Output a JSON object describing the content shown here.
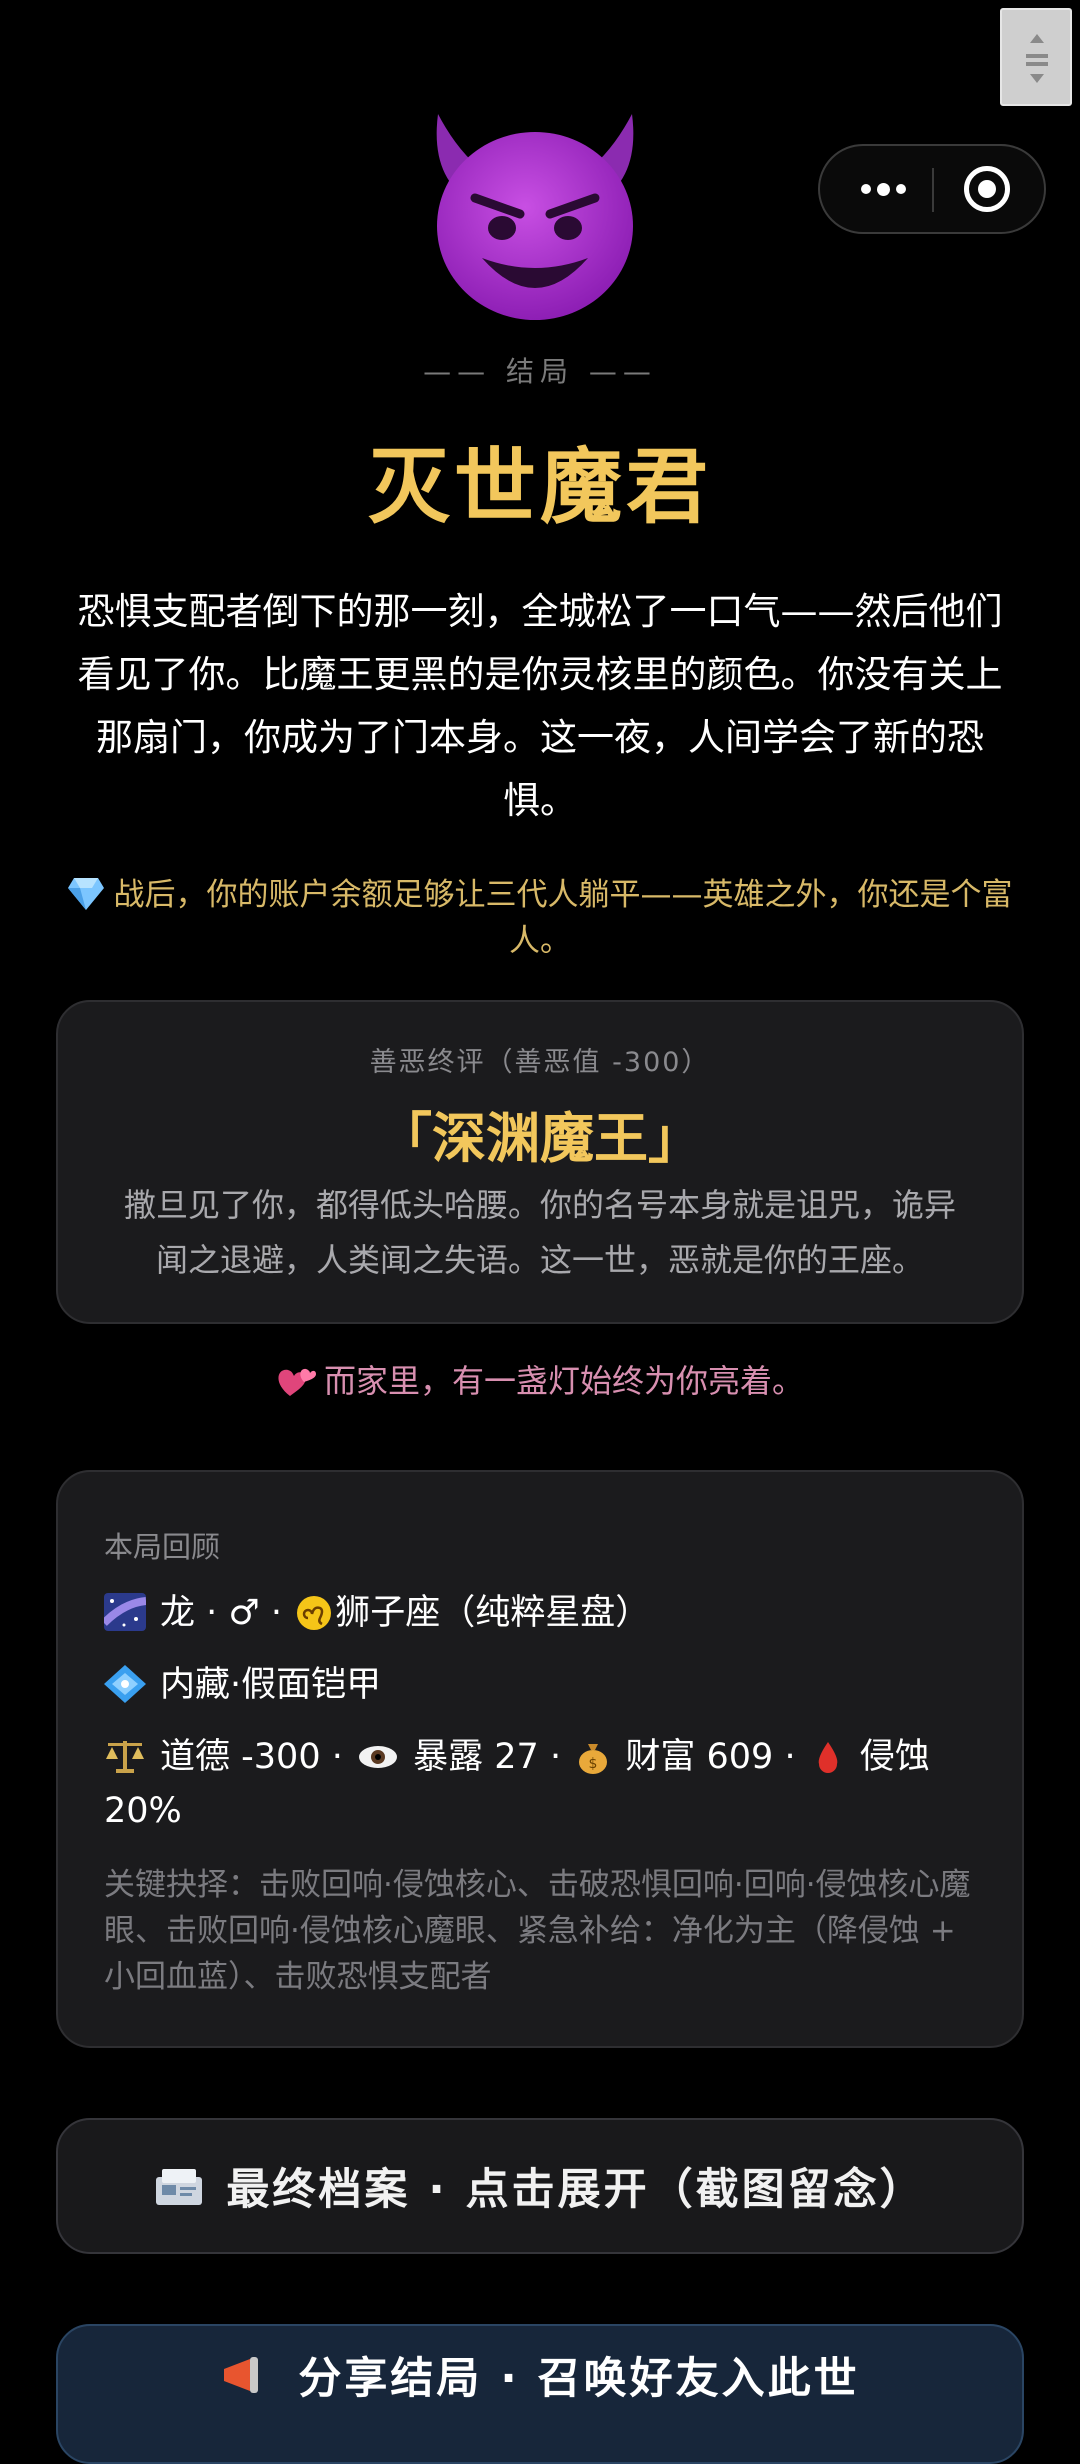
{
  "ending": {
    "label": "—— 结局 ——",
    "title": "灭世魔君",
    "story": "恐惧支配者倒下的那一刻，全城松了一口气——然后他们看见了你。比魔王更黑的是你灵核里的颜色。你没有关上那扇门，你成为了门本身。这一夜，人间学会了新的恐惧。",
    "wealth_note": "战后，你的账户余额足够让三代人躺平——英雄之外，你还是个富人。"
  },
  "verdict": {
    "label": "善恶终评（善恶值 -300）",
    "name": "「深渊魔王」",
    "description": "撒旦见了你，都得低头哈腰。你的名号本身就是诅咒，诡异闻之退避，人类闻之失语。这一世，恶就是你的王座。"
  },
  "family_note": "而家里，有一盏灯始终为你亮着。",
  "recap": {
    "heading": "本局回顾",
    "identity": {
      "zodiac": "龙",
      "sep1": " · ",
      "gender": "♂",
      "sep2": " · ",
      "sign": "狮子座（纯粹星盘）"
    },
    "ability": "内藏·假面铠甲",
    "stats": {
      "morality_label": "道德",
      "morality": "-300",
      "exposure_label": "暴露",
      "exposure": "27",
      "wealth_label": "财富",
      "wealth": "609",
      "corrosion_label": "侵蚀",
      "corrosion": "20%"
    },
    "key_choices": "关键抉择：击败回响·侵蚀核心、击破恐惧回响·回响·侵蚀核心魔眼、击败回响·侵蚀核心魔眼、紧急补给：净化为主（降侵蚀 + 小回血蓝）、击败恐惧支配者"
  },
  "buttons": {
    "archive": "最终档案 · 点击展开（截图留念）",
    "share": "分享结局 · 召唤好友入此世"
  },
  "colors": {
    "accent_gold": "#f2c75c",
    "card_bg": "#1b1b1d",
    "share_bg": "#17263a",
    "family_pink": "#d88fb0"
  },
  "icons": {
    "devil": "smiling-face-with-horns-icon",
    "gem": "gem-icon",
    "heart": "two-hearts-icon",
    "galaxy": "milky-way-icon",
    "leo": "leo-icon",
    "diamond": "diamond-with-dot-icon",
    "scale": "balance-scale-icon",
    "eye": "eye-icon",
    "money": "money-bag-icon",
    "drop": "blood-drop-icon",
    "archive": "card-file-icon",
    "share": "megaphone-icon"
  }
}
